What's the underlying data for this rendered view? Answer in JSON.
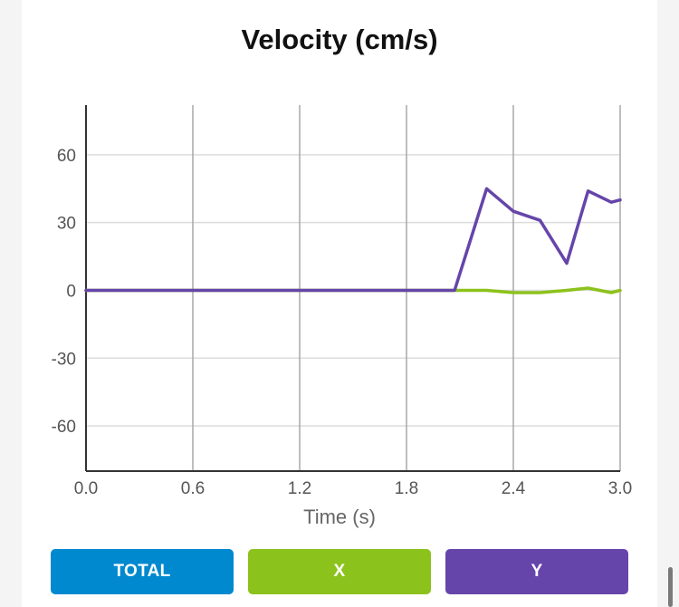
{
  "chart_data": {
    "type": "line",
    "title": "Velocity (cm/s)",
    "xlabel": "Time (s)",
    "ylabel": "",
    "xlim": [
      0.0,
      3.0
    ],
    "ylim": [
      -80,
      82
    ],
    "x_ticks": [
      "0.0",
      "0.6",
      "1.2",
      "1.8",
      "2.4",
      "3.0"
    ],
    "x_tick_values": [
      0.0,
      0.6,
      1.2,
      1.8,
      2.4,
      3.0
    ],
    "y_ticks": [
      "60",
      "30",
      "0",
      "-30",
      "-60"
    ],
    "y_tick_values": [
      60,
      30,
      0,
      -30,
      -60
    ],
    "grid": true,
    "series": [
      {
        "color": "#8cc21c",
        "x": [
          0.0,
          2.07,
          2.25,
          2.4,
          2.55,
          2.7,
          2.82,
          2.95,
          3.0
        ],
        "y": [
          0,
          0,
          0,
          -1,
          -1,
          0,
          1,
          -1,
          0
        ]
      },
      {
        "color": "#6645aa",
        "x": [
          0.0,
          2.07,
          2.25,
          2.4,
          2.55,
          2.7,
          2.82,
          2.95,
          3.0
        ],
        "y": [
          0,
          0,
          45,
          35,
          31,
          12,
          44,
          39,
          40
        ]
      }
    ]
  },
  "buttons": {
    "total": "TOTAL",
    "x": "X",
    "y": "Y",
    "colors": {
      "total": "#0089cf",
      "x": "#8cc21c",
      "y": "#6645aa"
    }
  }
}
